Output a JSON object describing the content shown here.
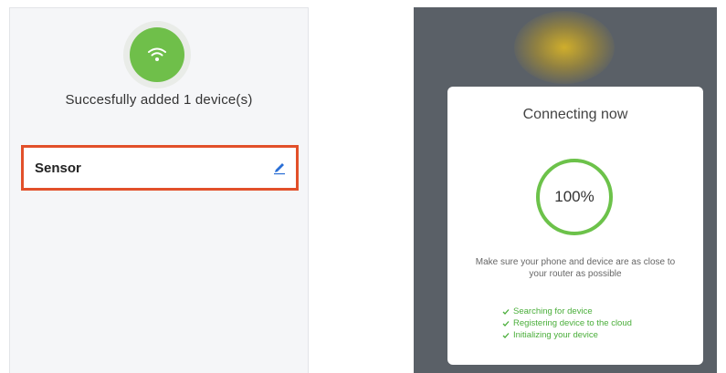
{
  "left": {
    "success_message": "Succesfully added 1 device(s)",
    "device": {
      "name": "Sensor"
    },
    "icons": {
      "status": "wifi-icon",
      "edit": "pencil-icon"
    },
    "colors": {
      "success_green": "#6fbf4a",
      "highlight_border": "#e2502a",
      "edit_blue": "#2a6fd6"
    }
  },
  "right": {
    "title": "Connecting now",
    "progress": {
      "value": 100,
      "label": "100%"
    },
    "hint": "Make sure your phone and device are as close to your router as possible",
    "steps": [
      {
        "label": "Searching for device",
        "done": true
      },
      {
        "label": "Registering device to the cloud",
        "done": true
      },
      {
        "label": "Initializing your device",
        "done": true
      }
    ],
    "colors": {
      "ring": "#6cc24a",
      "step_text": "#4aae3a",
      "overlay": "#5a6067"
    }
  }
}
